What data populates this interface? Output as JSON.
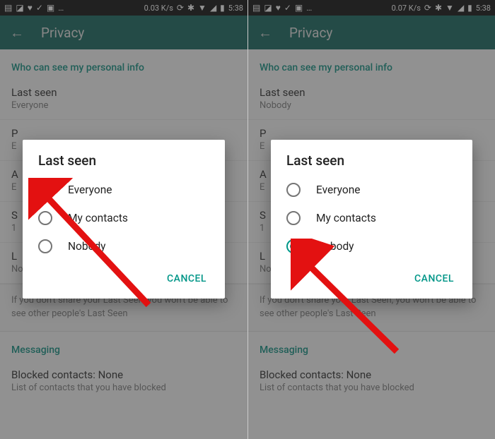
{
  "statusbar": {
    "left_icons": [
      "▤",
      "◪",
      "♥",
      "✓",
      "▣",
      "…"
    ],
    "net_l": "0.03 K/s",
    "net_r": "0.07 K/s",
    "right_icons": [
      "⟳",
      "✱",
      "▼",
      "◢",
      "▮"
    ],
    "time": "5:38"
  },
  "toolbar": {
    "back": "←",
    "title": "Privacy"
  },
  "section1": "Who can see my personal info",
  "last_seen_label": "Last seen",
  "left_value": "Everyone",
  "right_value": "Nobody",
  "hidden_rows": [
    {
      "t": "P",
      "v": "E"
    },
    {
      "t": "A",
      "v": "E"
    },
    {
      "t": "S",
      "v": "1"
    },
    {
      "t": "L",
      "v": "None"
    }
  ],
  "disclaimer": "If you don't share your Last Seen, you won't be able to see other people's Last Seen",
  "section2": "Messaging",
  "blocked_title": "Blocked contacts: None",
  "blocked_sub": "List of contacts that you have blocked",
  "dialog": {
    "title": "Last seen",
    "options": [
      "Everyone",
      "My contacts",
      "Nobody"
    ],
    "cancel": "CANCEL",
    "checked_left": 0,
    "checked_right": 2
  }
}
